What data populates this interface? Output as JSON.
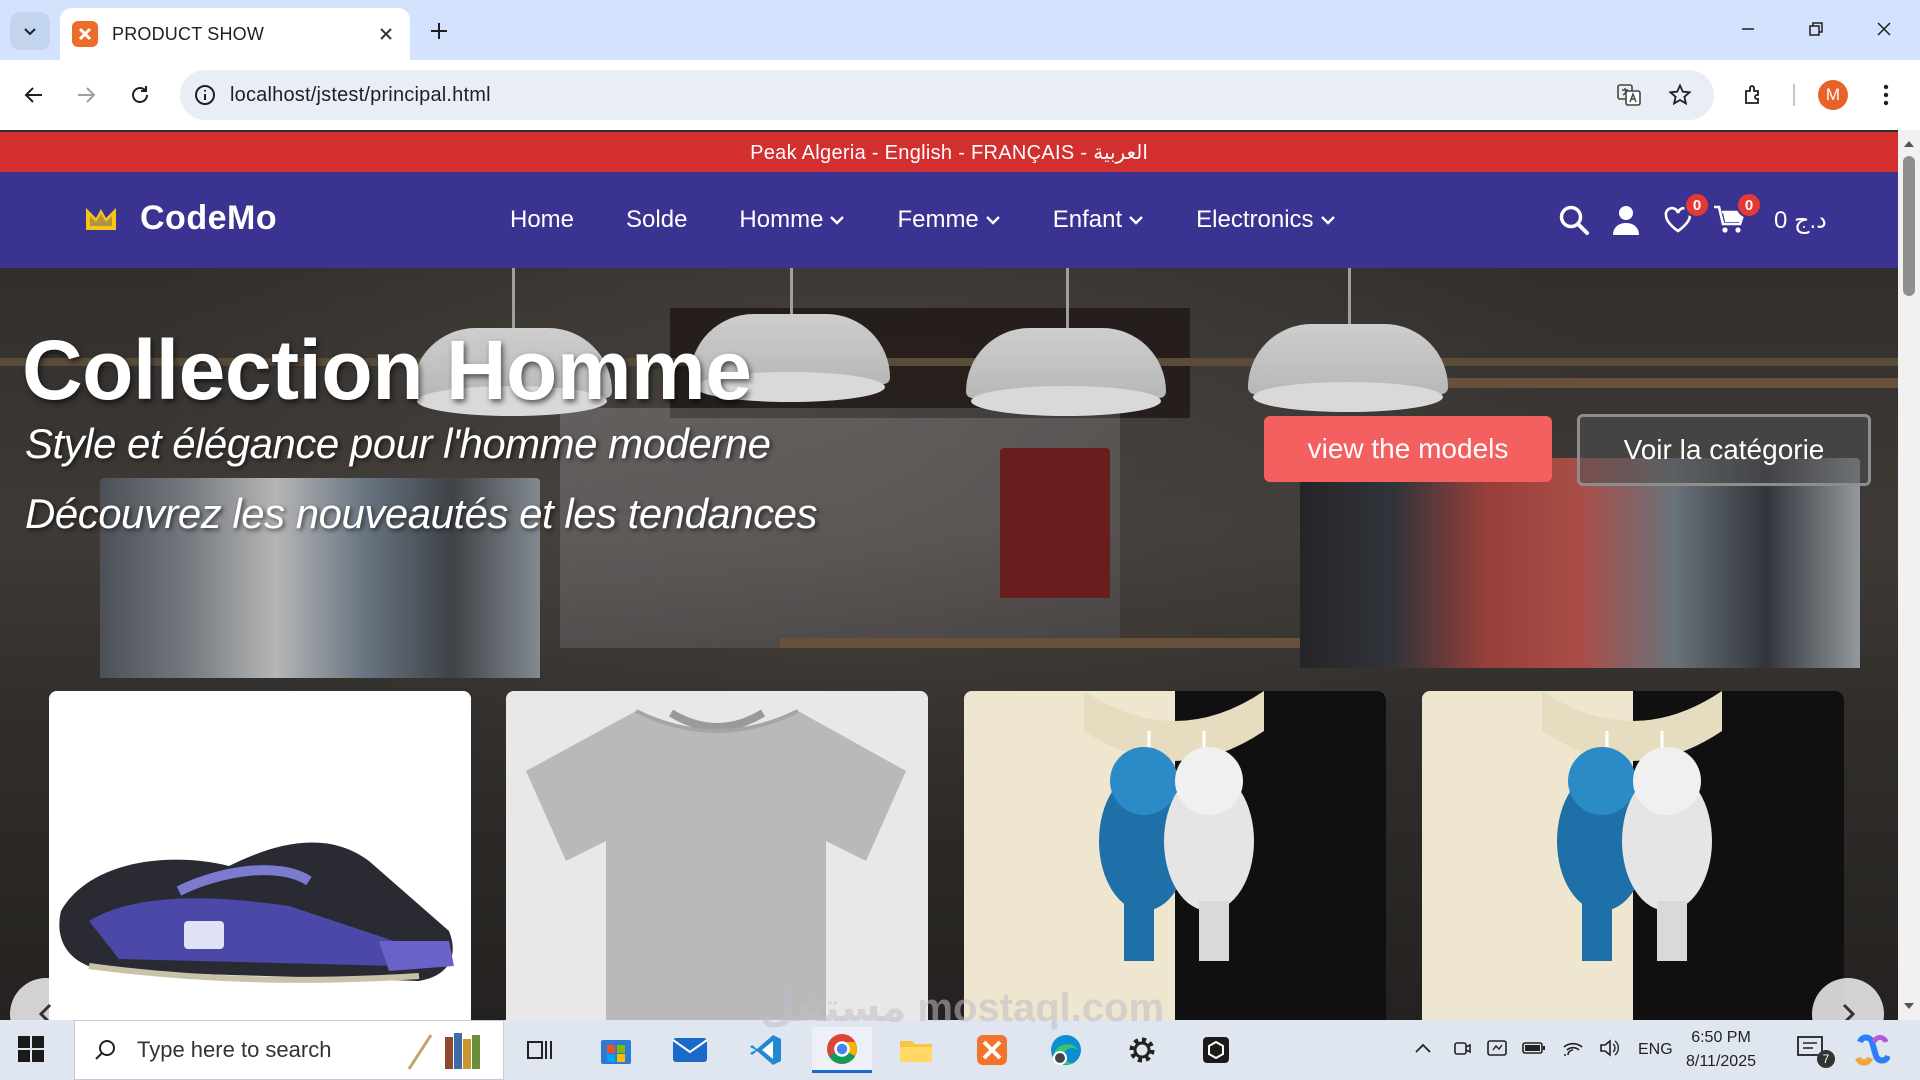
{
  "browser": {
    "tab_title": "PRODUCT SHOW",
    "url": "localhost/jstest/principal.html",
    "profile_initial": "M"
  },
  "page": {
    "topbar_text": "Peak Algeria - English - FRANÇAIS - العربية",
    "logo_text": "CodeMo",
    "nav": [
      {
        "label": "Home",
        "dropdown": false
      },
      {
        "label": "Solde",
        "dropdown": false
      },
      {
        "label": "Homme",
        "dropdown": true
      },
      {
        "label": "Femme",
        "dropdown": true
      },
      {
        "label": "Enfant",
        "dropdown": true
      },
      {
        "label": "Electronics",
        "dropdown": true
      }
    ],
    "wishlist_count": "0",
    "cart_count": "0",
    "cart_total": "0 د.ج",
    "hero": {
      "title": "Collection Homme",
      "subtitle1": "Style et élégance pour l'homme moderne",
      "subtitle2": "Découvrez les nouveautés et les tendances",
      "btn_models": "view the models",
      "btn_category": "Voir la catégorie"
    },
    "products": [
      {
        "name": "sneaker",
        "icon": "shoe-image"
      },
      {
        "name": "grey t-shirt",
        "icon": "tshirt-image"
      },
      {
        "name": "bear hoodie t-shirt",
        "icon": "hoodie-image"
      },
      {
        "name": "bear hoodie t-shirt",
        "icon": "hoodie-image"
      }
    ],
    "colors": {
      "topbar": "#d32f2f",
      "navbar": "#3a3391",
      "btn_models": "#f45f5f",
      "badge": "#e53935",
      "logo": "#f5c518"
    }
  },
  "taskbar": {
    "search_placeholder": "Type here to search",
    "language": "ENG",
    "time": "6:50 PM",
    "date": "8/11/2025",
    "notification_count": "7"
  },
  "watermark": "مستقل mostaql.com"
}
